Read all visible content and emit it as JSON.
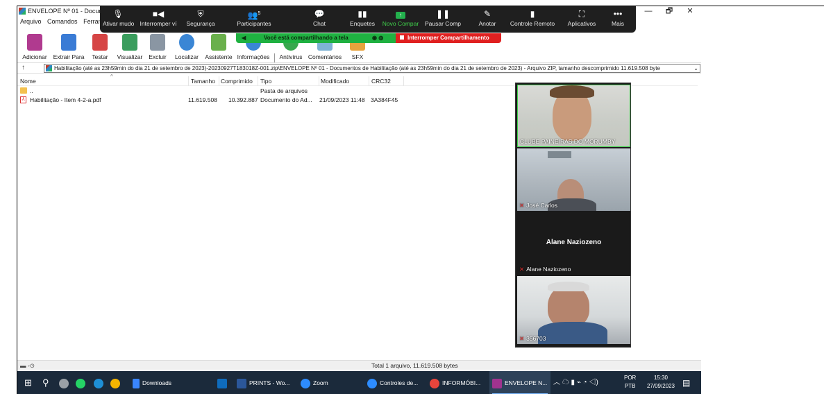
{
  "window": {
    "title": "ENVELOPE Nº 01 - Docume",
    "controls": {
      "minimize": "—",
      "maximize": "🗗",
      "close": "✕"
    }
  },
  "menu": [
    "Arquivo",
    "Comandos",
    "Ferram"
  ],
  "zoom_toolbar": {
    "items": [
      {
        "label": "Ativar mudo",
        "icon": "microphone-icon",
        "glyph": "🎙"
      },
      {
        "label": "Interromper ví",
        "icon": "video-camera-icon",
        "glyph": "■◀"
      },
      {
        "label": "Segurança",
        "icon": "shield-icon",
        "glyph": "⛨"
      },
      {
        "label": "Participantes",
        "icon": "participants-icon",
        "glyph": "👥",
        "count": "5"
      },
      {
        "label": "Chat",
        "icon": "chat-icon",
        "glyph": "💬"
      },
      {
        "label": "Enquetes",
        "icon": "poll-icon",
        "glyph": "▮▮"
      },
      {
        "label": "Novo Compar",
        "icon": "new-share-icon",
        "glyph": "↑"
      },
      {
        "label": "Pausar Comp",
        "icon": "pause-share-icon",
        "glyph": "❚❚"
      },
      {
        "label": "Anotar",
        "icon": "annotate-icon",
        "glyph": "✎"
      },
      {
        "label": "Controle Remoto",
        "icon": "remote-control-icon",
        "glyph": "▮"
      },
      {
        "label": "Aplicativos",
        "icon": "apps-icon",
        "glyph": "⛶"
      },
      {
        "label": "Mais",
        "icon": "more-icon",
        "glyph": "•••"
      }
    ],
    "sharing_text": "Você está compartilhando a tela",
    "stop_share": "Interromper Compartilhamento"
  },
  "toolbar": {
    "buttons": [
      {
        "label": "Adicionar",
        "icon": "add-archive-icon",
        "color": "#b03a8f"
      },
      {
        "label": "Extrair Para",
        "icon": "extract-folder-icon",
        "color": "#3a7bd5"
      },
      {
        "label": "Testar",
        "icon": "test-icon",
        "color": "#d64545"
      },
      {
        "label": "Visualizar",
        "icon": "view-book-icon",
        "color": "#3a9d5d"
      },
      {
        "label": "Excluir",
        "icon": "trash-icon",
        "color": "#8a96a3"
      },
      {
        "label": "Localizar",
        "icon": "magnifier-icon",
        "color": "#3a86d5"
      },
      {
        "label": "Assistente",
        "icon": "wizard-wand-icon",
        "color": "#6ab04c"
      },
      {
        "label": "Informações",
        "icon": "info-icon",
        "color": "#3a86d5"
      },
      {
        "label": "Antivírus",
        "icon": "antivirus-icon",
        "color": "#38a84e"
      },
      {
        "label": "Comentários",
        "icon": "comment-icon",
        "color": "#7fb3d5"
      },
      {
        "label": "SFX",
        "icon": "sfx-icon",
        "color": "#e8a33d"
      }
    ]
  },
  "address": {
    "up_glyph": "↑",
    "path": "Habilitação (até as 23h59min do dia 21 de setembro de 2023)-20230927T183018Z-001.zip\\ENVELOPE Nº 01 - Documentos de Habilitação (até as 23h59min do dia 21 de setembro de 2023) - Arquivo ZIP, tamanho descomprimido 11.619.508 byte"
  },
  "file_list": {
    "columns": [
      "Nome",
      "Tamanho",
      "Comprimido",
      "Tipo",
      "Modificado",
      "CRC32"
    ],
    "rows": [
      {
        "name": "..",
        "size": "",
        "compressed": "",
        "type": "Pasta de arquivos",
        "modified": "",
        "crc": "",
        "kind": "folder"
      },
      {
        "name": "Habilitação - Item 4-2-a.pdf",
        "size": "11.619.508",
        "compressed": "10.392.887",
        "type": "Documento do Ad...",
        "modified": "21/09/2023 11:48",
        "crc": "3A384F45",
        "kind": "pdf"
      }
    ]
  },
  "video_tiles": [
    {
      "name": "CLUBE PAINEIRAS DO MORUMBY",
      "muted": false
    },
    {
      "name": "José Carlos",
      "muted": true
    },
    {
      "name": "Alane Naziozeno",
      "center_name": "Alane Naziozeno",
      "muted": true
    },
    {
      "name": "356703",
      "muted": true
    }
  ],
  "statusbar": {
    "total": "Total 1 arquivo, 11.619.508 bytes"
  },
  "taskbar": {
    "items": [
      {
        "label": "Downloads",
        "icon": "download-arrow-icon",
        "color": "#3a86ff"
      },
      {
        "label": "PRINTS - Wo...",
        "icon": "word-icon",
        "color": "#2b579a"
      },
      {
        "label": "Zoom",
        "icon": "zoom-icon",
        "color": "#2d8cff"
      },
      {
        "label": "Controles de...",
        "icon": "zoom-icon",
        "color": "#2d8cff"
      },
      {
        "label": "INFORMÓBI...",
        "icon": "chrome-icon",
        "color": "#e8453c"
      },
      {
        "label": "ENVELOPE N...",
        "icon": "winrar-icon",
        "color": "#a1338f"
      }
    ],
    "lang_top": "POR",
    "lang_bottom": "PTB",
    "time": "15:30",
    "date": "27/09/2023"
  }
}
